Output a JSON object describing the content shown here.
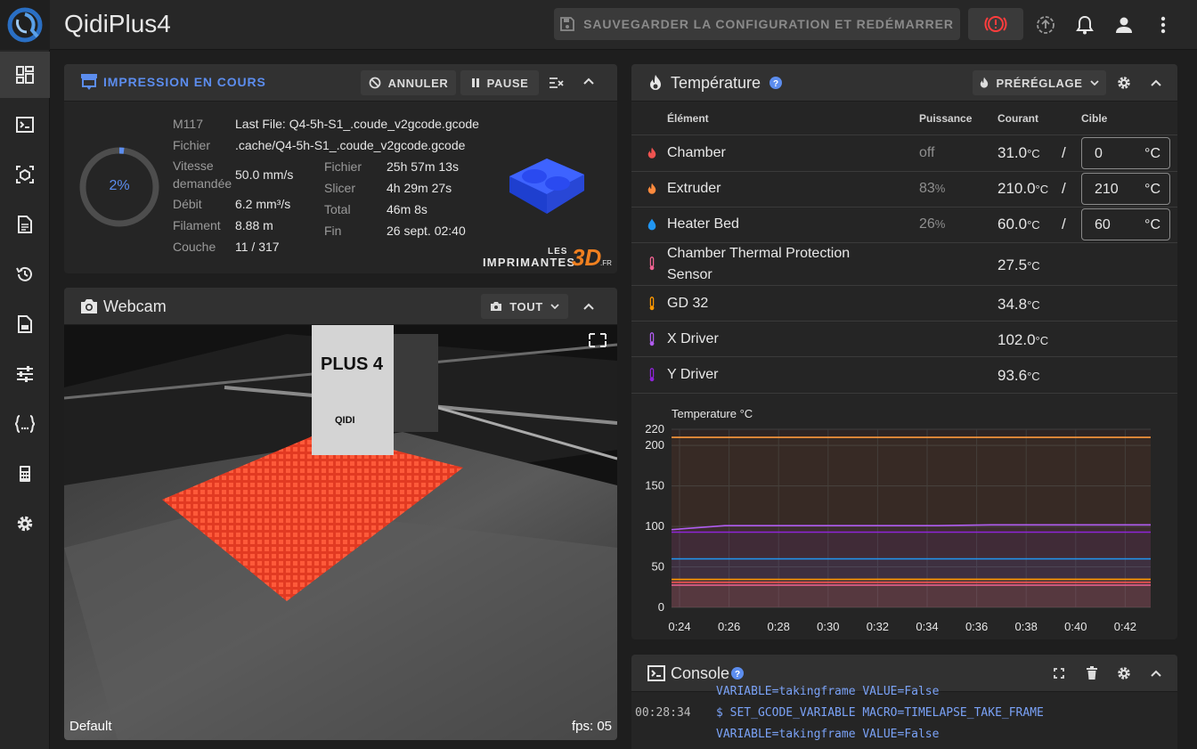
{
  "app": {
    "title": "QidiPlus4"
  },
  "topbar": {
    "save_restart_label": "SAUVEGARDER LA CONFIGURATION ET REDÉMARRER"
  },
  "status_panel": {
    "title": "IMPRESSION EN COURS",
    "cancel_label": "ANNULER",
    "pause_label": "PAUSE",
    "progress": "2%",
    "progress_fraction": 0.02,
    "m117_label": "M117",
    "m117_value": "Last File: Q4-5h-S1_.coude_v2gcode.gcode",
    "file_label": "Fichier",
    "file_value": ".cache/Q4-5h-S1_.coude_v2gcode.gcode",
    "speed_label_1": "Vitesse",
    "speed_label_2": "demandée",
    "speed_value": "50.0 mm/s",
    "flow_label": "Débit",
    "flow_value": "6.2 mm³/s",
    "filament_label": "Filament",
    "filament_value": "8.88 m",
    "layer_label": "Couche",
    "layer_value": "11 / 317",
    "file_time_label": "Fichier",
    "file_time_value": "25h 57m 13s",
    "slicer_label": "Slicer",
    "slicer_value": "4h 29m 27s",
    "total_label": "Total",
    "total_value": "46m 8s",
    "eta_label": "Fin",
    "eta_value": "26 sept. 02:40",
    "watermark_les": "LES",
    "watermark_impr": "IMPRIMANTES",
    "watermark_3d": "3D",
    "watermark_fr": ".FR"
  },
  "webcam_panel": {
    "title": "Webcam",
    "filter_label": "TOUT",
    "cam_name": "Default",
    "fps": "fps: 05",
    "plus4_text": "PLUS 4",
    "qidi_text": "QIDI"
  },
  "temp_panel": {
    "title": "Température",
    "preset_label": "PRÉRÉGLAGE",
    "headers": {
      "element": "Élément",
      "power": "Puissance",
      "current": "Courant",
      "target": "Cible"
    },
    "rows": [
      {
        "name": "Chamber",
        "power": "off",
        "current": "31.0",
        "unit": "°C",
        "target": "0",
        "target_unit": "°C",
        "slash": "/",
        "color": "#ef5350"
      },
      {
        "name": "Extruder",
        "power": "83",
        "power_unit": "%",
        "current": "210.0",
        "unit": "°C",
        "target": "210",
        "target_unit": "°C",
        "slash": "/",
        "color": "#ff8a3d"
      },
      {
        "name": "Heater Bed",
        "power": "26",
        "power_unit": "%",
        "current": "60.0",
        "unit": "°C",
        "target": "60",
        "target_unit": "°C",
        "slash": "/",
        "color": "#2196f3"
      },
      {
        "name_1": "Chamber Thermal Protection",
        "name_2": "Sensor",
        "current": "27.5",
        "unit": "°C",
        "color": "#f06292"
      },
      {
        "name": "GD 32",
        "current": "34.8",
        "unit": "°C",
        "color": "#ff9800"
      },
      {
        "name": "X Driver",
        "current": "102.0",
        "unit": "°C",
        "color": "#b05cf0"
      },
      {
        "name": "Y Driver",
        "current": "93.6",
        "unit": "°C",
        "color": "#8e24d8"
      }
    ]
  },
  "chart_data": {
    "type": "line",
    "title": "Temperature °C",
    "x": [
      "0:24",
      "0:26",
      "0:28",
      "0:30",
      "0:32",
      "0:34",
      "0:36",
      "0:38",
      "0:40",
      "0:42"
    ],
    "yticks": [
      0,
      50,
      100,
      150,
      200,
      220
    ],
    "ylim": [
      0,
      220
    ],
    "series": [
      {
        "color": "#ff9a3c",
        "values": [
          210,
          210,
          210,
          210,
          210,
          210,
          210,
          210,
          210,
          210
        ]
      },
      {
        "color": "#b05cf0",
        "values": [
          96,
          101,
          101,
          101,
          101,
          101,
          102,
          102,
          102,
          102
        ]
      },
      {
        "color": "#8e24d8",
        "values": [
          93,
          93,
          93,
          93,
          93,
          93,
          93,
          93,
          93,
          93
        ]
      },
      {
        "color": "#2196f3",
        "values": [
          60,
          60,
          60,
          60,
          60,
          60,
          60,
          60,
          60,
          60
        ]
      },
      {
        "color": "#ff9800",
        "values": [
          34.5,
          34.6,
          34.7,
          34.7,
          34.8,
          34.8,
          34.8,
          34.8,
          34.8,
          34.8
        ]
      },
      {
        "color": "#ef5350",
        "values": [
          31,
          31,
          31,
          31,
          31,
          31,
          31,
          31,
          31,
          31
        ]
      },
      {
        "color": "#f06292",
        "values": [
          27.5,
          27.5,
          27.5,
          27.5,
          27.5,
          27.5,
          27.5,
          27.5,
          27.5,
          27.5
        ]
      }
    ]
  },
  "console_panel": {
    "title": "Console",
    "line0": "VARIABLE=takingframe VALUE=False",
    "time1": "00:28:34",
    "line1": "$ SET_GCODE_VARIABLE MACRO=TIMELAPSE_TAKE_FRAME",
    "line2": "VARIABLE=takingframe VALUE=False"
  }
}
